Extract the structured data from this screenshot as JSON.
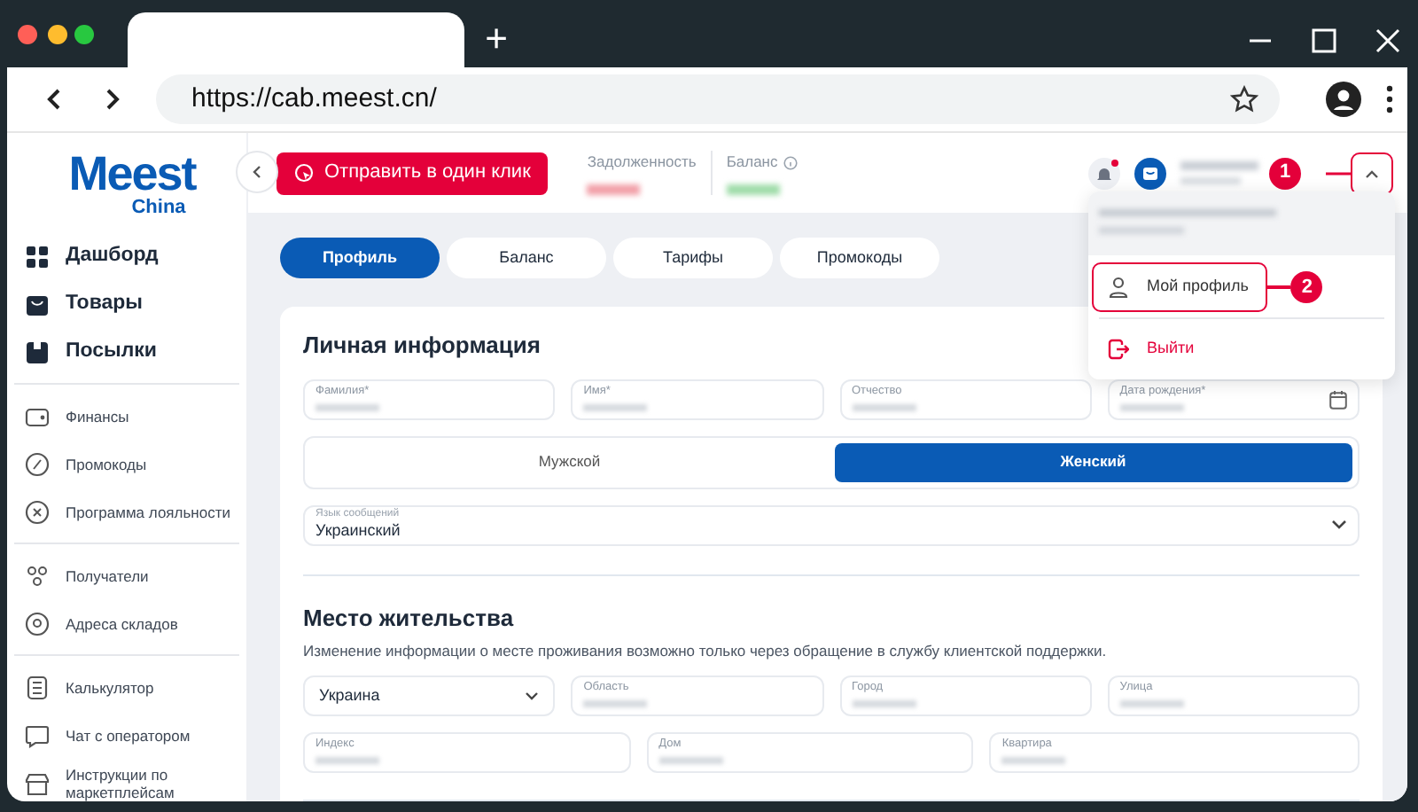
{
  "browser": {
    "new_tab": "+",
    "url": "https://cab.meest.cn/"
  },
  "logo": {
    "name": "Meest",
    "sub": "China"
  },
  "sidebar": {
    "groups": [
      {
        "items": [
          {
            "label": "Дашборд",
            "kind": "main"
          },
          {
            "label": "Товары",
            "kind": "main"
          },
          {
            "label": "Посылки",
            "kind": "main"
          }
        ]
      },
      {
        "items": [
          {
            "label": "Финансы",
            "kind": "sub"
          },
          {
            "label": "Промокоды",
            "kind": "sub"
          },
          {
            "label": "Программа лояльности",
            "kind": "sub"
          }
        ]
      },
      {
        "items": [
          {
            "label": "Получатели",
            "kind": "sub"
          },
          {
            "label": "Адреса складов",
            "kind": "sub"
          }
        ]
      },
      {
        "items": [
          {
            "label": "Калькулятор",
            "kind": "sub"
          },
          {
            "label": "Чат с оператором",
            "kind": "sub"
          },
          {
            "label": "Инструкции по маркетплейсам",
            "kind": "sub"
          }
        ]
      }
    ]
  },
  "header": {
    "send_button": "Отправить в один клик",
    "stats": [
      {
        "label": "Задолженность",
        "info": false,
        "color": "#f2a0a8"
      },
      {
        "label": "Баланс",
        "info": true,
        "color": "#9fdca9"
      }
    ],
    "notification_dot": true,
    "menu_expanded": true
  },
  "user_menu": {
    "items": [
      {
        "label": "Мой профиль",
        "kind": "profile",
        "highlighted": true
      },
      {
        "label": "Выйти",
        "kind": "logout",
        "highlighted": false
      }
    ]
  },
  "annotations": [
    {
      "number": "1"
    },
    {
      "number": "2"
    }
  ],
  "tabs": [
    {
      "label": "Профиль",
      "selected": true
    },
    {
      "label": "Баланс",
      "selected": false
    },
    {
      "label": "Тарифы",
      "selected": false
    },
    {
      "label": "Промокоды",
      "selected": false
    }
  ],
  "personal": {
    "title": "Личная информация",
    "fields": [
      {
        "label": "Фамилия*",
        "kind": "text"
      },
      {
        "label": "Имя*",
        "kind": "text"
      },
      {
        "label": "Отчество",
        "kind": "text"
      },
      {
        "label": "Дата рождения*",
        "kind": "date"
      }
    ],
    "gender": [
      {
        "label": "Мужской",
        "selected": false
      },
      {
        "label": "Женский",
        "selected": true
      }
    ],
    "language": {
      "label": "Язык сообщений",
      "value": "Украинский"
    }
  },
  "residence": {
    "title": "Место жительства",
    "note": "Изменение информации о месте проживания возможно только через обращение в службу клиентской поддержки.",
    "country": "Украина",
    "row_1": [
      {
        "label": "Область"
      },
      {
        "label": "Город"
      },
      {
        "label": "Улица"
      }
    ],
    "row_2": [
      {
        "label": "Индекс"
      },
      {
        "label": "Дом"
      },
      {
        "label": "Квартира"
      }
    ]
  }
}
